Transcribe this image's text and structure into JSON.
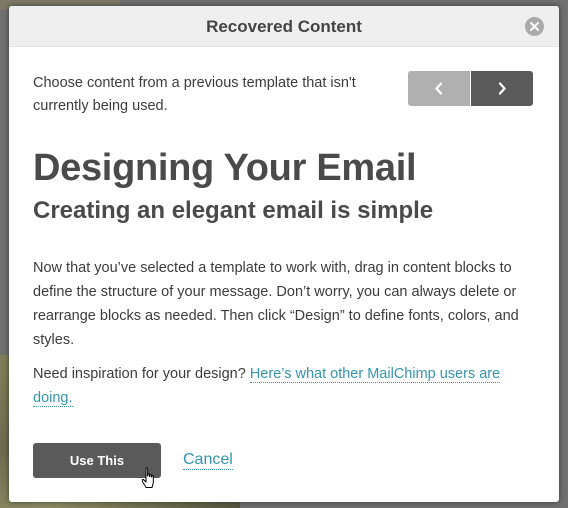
{
  "dialog": {
    "title": "Recovered Content",
    "intro": "Choose content from a previous template that isn't currently being used.",
    "heading": "Designing Your Email",
    "subheading": "Creating an elegant email is simple",
    "body": "Now that you’ve selected a template to work with, drag in content blocks to define the structure of your message. Don’t worry, you can always delete or rearrange blocks as needed. Then click “Design” to define fonts, colors, and styles.",
    "inspiration_prefix": "Need inspiration for your design?",
    "inspiration_link": "Here’s what other MailChimp users are doing.",
    "use_button": "Use This",
    "cancel_link": "Cancel"
  },
  "icons": {
    "close": "close-icon",
    "prev": "chevron-left-icon",
    "next": "chevron-right-icon",
    "cursor": "hand-pointer-icon"
  },
  "colors": {
    "accent_link": "#3495ad",
    "button_dark": "#5a5a5a",
    "button_disabled": "#b0b0b0",
    "header_bg": "#efefef"
  }
}
